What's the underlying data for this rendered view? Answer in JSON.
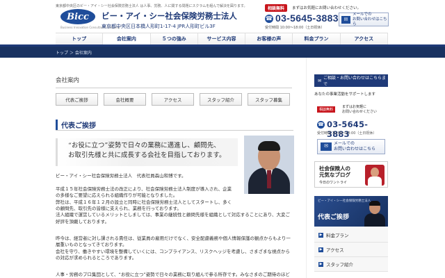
{
  "header": {
    "tagline": "東京都中央区のビー・アイ・シー社会保険労務士法人 は人事、労務、人に関する問題にスクラムを組んで解決を図ります。",
    "logo_text": "Bicc",
    "logo_sub": "Business Innovation Consultants Company",
    "company_name": "ビー・アイ・シー社会保険労務士法人",
    "address": "東京都中央区日本橋人形町1-17-4 JPR人形町ビル3F",
    "consult_badge": "相談無料",
    "consult_text": "まずはお気軽にお問い合わせください。",
    "phone": "03-5645-3883",
    "hours": "受付時間 10:00～18:00（土日祝休）",
    "mail_line1": "メールでの",
    "mail_line2": "お問い合わせはこちら"
  },
  "nav": {
    "items": [
      {
        "label": "トップ"
      },
      {
        "label": "会社案内"
      },
      {
        "label": "５つの強み"
      },
      {
        "label": "サービス内容"
      },
      {
        "label": "お客様の声"
      },
      {
        "label": "料金プラン"
      },
      {
        "label": "アクセス"
      }
    ],
    "active": "会社案内"
  },
  "breadcrumb": "トップ ＞ 会社案内",
  "main": {
    "section_title": "会社案内",
    "tabs": [
      {
        "label": "代表ご挨拶"
      },
      {
        "label": "会社概要"
      },
      {
        "label": "アクセス"
      },
      {
        "label": "スタッフ紹介"
      },
      {
        "label": "スタッフ募集"
      }
    ],
    "greeting_title": "代表ご挨拶",
    "quote_line1": "“お役に立つ”姿勢で日々の業務に邁進し、顧問先、",
    "quote_line2": "お取引先様と共に成長する会社を目指しております。",
    "signature": "ビー・アイ・シー社会保険労務士法人　代表社員森山和博です。",
    "para1": [
      "平成１５年社会保険労務士法の改正により、社会保険労務士法人制度が導入され、企業",
      "の多様なご要望に応えられる組織作りが可能となりました。",
      "弊社は、平成１６年１２月の設立と同時に社会保険労務士法人としてスタートし、多く",
      "の顧問先、取引先の皆様に支えられ、業務を行っております。",
      "法人組織で運営しているメリットとしましては、事業の継続性と顧問先様を組織として対応することにあり、大変ご",
      "好評を頂戴しております。"
    ],
    "para2": [
      "昨今は、経営者に対し課される責任は、従業員の雇用だけでなく、安全配慮義務や個人情報保護の観点からもより一",
      "層重いものとなってきております。",
      "会社を守り、働きやすい環境を整備していくには、コンプライアンス、リスクヘッジを考慮し、さまざまな視点から",
      "の対応が求められるところであります。"
    ],
    "para3": "人事・労務のプロ集団として、“お役に立つ”姿勢で日々の業務に取り組んで参る所存です。みなさまのご期待のほど"
  },
  "sidebar": {
    "contact_head": "ご相談・お問い合わせはこちらまで",
    "support_text": "あなたの事業活動をサポートします",
    "badge": "相談無料",
    "small_line1": "まずはお気軽に",
    "small_line2": "お問い合わせください",
    "phone": "03-5645-3883",
    "hours": "受付時間 10:00～18:00（土日祝休）",
    "mail_line1": "メールでの",
    "mail_line2": "お問い合わせはこちら",
    "blog_line1": "社会保険人の",
    "blog_line2": "元気なブログ",
    "blog_sub": "今日のワントライ",
    "banner_small": "ビー・アイ・シー社会保険労務士法人",
    "banner_big": "代表ご挨拶",
    "menu": [
      {
        "label": "料金プラン"
      },
      {
        "label": "アクセス"
      },
      {
        "label": "スタッフ紹介"
      }
    ]
  },
  "colors": {
    "brand_navy": "#1f3a78",
    "accent_red": "#c8161d",
    "breadcrumb_bg": "#193261"
  }
}
